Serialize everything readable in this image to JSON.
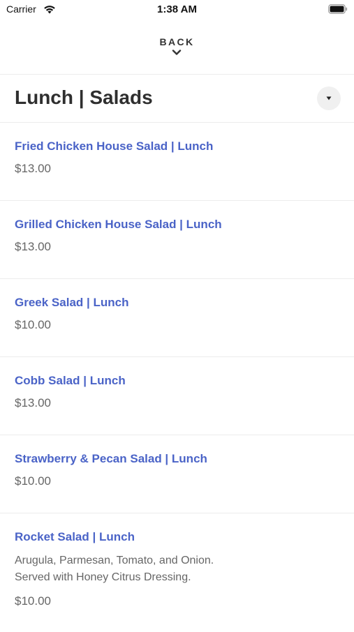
{
  "status_bar": {
    "carrier": "Carrier",
    "time": "1:38 AM"
  },
  "header": {
    "back_label": "BACK"
  },
  "category": {
    "title": "Lunch | Salads"
  },
  "items": [
    {
      "name": "Fried Chicken House Salad | Lunch",
      "price": "$13.00"
    },
    {
      "name": "Grilled Chicken House Salad | Lunch",
      "price": "$13.00"
    },
    {
      "name": "Greek Salad | Lunch",
      "price": "$10.00"
    },
    {
      "name": "Cobb Salad | Lunch",
      "price": "$13.00"
    },
    {
      "name": "Strawberry & Pecan Salad | Lunch",
      "price": "$10.00"
    },
    {
      "name": "Rocket Salad | Lunch",
      "description_line1": "Arugula, Parmesan, Tomato, and Onion.",
      "description_line2": "Served with Honey Citrus Dressing.",
      "price": "$10.00"
    }
  ],
  "colors": {
    "accent": "#4a63c7",
    "divider": "#ececec"
  },
  "icons": {
    "wifi": "wifi-icon",
    "battery": "battery-icon",
    "back": "chevron-down-icon",
    "dropdown": "caret-down-icon"
  }
}
